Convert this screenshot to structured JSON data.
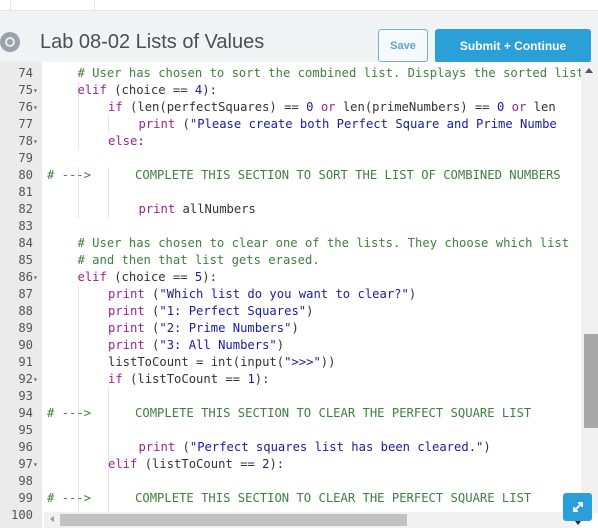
{
  "header": {
    "icon": "gear-icon",
    "title": "Lab 08-02 Lists of Values",
    "save_label": "Save",
    "submit_label": "Submit + Continue"
  },
  "colors": {
    "accent": "#2ba0d8",
    "comment": "#3f7f3f",
    "keyword": "#9b2393",
    "string": "#1a1aa6"
  },
  "editor": {
    "lines": [
      {
        "n": "74",
        "fold": false,
        "indent": 1,
        "tokens": [
          {
            "t": "cm",
            "v": "# User has chosen to sort the combined list. Displays the sorted list"
          }
        ]
      },
      {
        "n": "75",
        "fold": true,
        "indent": 1,
        "tokens": [
          {
            "t": "kw",
            "v": "elif"
          },
          {
            "t": "plain",
            "v": " (choice == "
          },
          {
            "t": "num",
            "v": "4"
          },
          {
            "t": "plain",
            "v": "):"
          }
        ]
      },
      {
        "n": "76",
        "fold": true,
        "indent": 2,
        "tokens": [
          {
            "t": "kw",
            "v": "if"
          },
          {
            "t": "plain",
            "v": " (len(perfectSquares) == "
          },
          {
            "t": "num",
            "v": "0"
          },
          {
            "t": "plain",
            "v": " "
          },
          {
            "t": "kw",
            "v": "or"
          },
          {
            "t": "plain",
            "v": " len(primeNumbers) == "
          },
          {
            "t": "num",
            "v": "0"
          },
          {
            "t": "plain",
            "v": " "
          },
          {
            "t": "kw",
            "v": "or"
          },
          {
            "t": "plain",
            "v": " len"
          }
        ]
      },
      {
        "n": "77",
        "fold": false,
        "indent": 3,
        "tokens": [
          {
            "t": "kw",
            "v": "print"
          },
          {
            "t": "plain",
            "v": " ("
          },
          {
            "t": "str",
            "v": "\"Please create both Perfect Square and Prime Numbe"
          }
        ]
      },
      {
        "n": "78",
        "fold": true,
        "indent": 2,
        "tokens": [
          {
            "t": "kw",
            "v": "else"
          },
          {
            "t": "plain",
            "v": ":"
          }
        ]
      },
      {
        "n": "79",
        "fold": false,
        "indent": 0,
        "tokens": []
      },
      {
        "n": "80",
        "fold": false,
        "indent": 0,
        "tokens": [
          {
            "t": "cm",
            "v": "# --->      COMPLETE THIS SECTION TO SORT THE LIST OF COMBINED NUMBERS"
          }
        ]
      },
      {
        "n": "81",
        "fold": false,
        "indent": 0,
        "tokens": []
      },
      {
        "n": "82",
        "fold": false,
        "indent": 3,
        "tokens": [
          {
            "t": "kw",
            "v": "print"
          },
          {
            "t": "plain",
            "v": " allNumbers"
          }
        ]
      },
      {
        "n": "83",
        "fold": false,
        "indent": 0,
        "tokens": []
      },
      {
        "n": "84",
        "fold": false,
        "indent": 1,
        "tokens": [
          {
            "t": "cm",
            "v": "# User has chosen to clear one of the lists. They choose which list"
          }
        ]
      },
      {
        "n": "85",
        "fold": false,
        "indent": 1,
        "tokens": [
          {
            "t": "cm",
            "v": "# and then that list gets erased."
          }
        ]
      },
      {
        "n": "86",
        "fold": true,
        "indent": 1,
        "tokens": [
          {
            "t": "kw",
            "v": "elif"
          },
          {
            "t": "plain",
            "v": " (choice == "
          },
          {
            "t": "num",
            "v": "5"
          },
          {
            "t": "plain",
            "v": "):"
          }
        ]
      },
      {
        "n": "87",
        "fold": false,
        "indent": 2,
        "tokens": [
          {
            "t": "kw",
            "v": "print"
          },
          {
            "t": "plain",
            "v": " ("
          },
          {
            "t": "str",
            "v": "\"Which list do you want to clear?\""
          },
          {
            "t": "plain",
            "v": ")"
          }
        ]
      },
      {
        "n": "88",
        "fold": false,
        "indent": 2,
        "tokens": [
          {
            "t": "kw",
            "v": "print"
          },
          {
            "t": "plain",
            "v": " ("
          },
          {
            "t": "str",
            "v": "\"1: Perfect Squares\""
          },
          {
            "t": "plain",
            "v": ")"
          }
        ]
      },
      {
        "n": "89",
        "fold": false,
        "indent": 2,
        "tokens": [
          {
            "t": "kw",
            "v": "print"
          },
          {
            "t": "plain",
            "v": " ("
          },
          {
            "t": "str",
            "v": "\"2: Prime Numbers\""
          },
          {
            "t": "plain",
            "v": ")"
          }
        ]
      },
      {
        "n": "90",
        "fold": false,
        "indent": 2,
        "tokens": [
          {
            "t": "kw",
            "v": "print"
          },
          {
            "t": "plain",
            "v": " ("
          },
          {
            "t": "str",
            "v": "\"3: All Numbers\""
          },
          {
            "t": "plain",
            "v": ")"
          }
        ]
      },
      {
        "n": "91",
        "fold": false,
        "indent": 2,
        "tokens": [
          {
            "t": "plain",
            "v": "listToCount = int(input("
          },
          {
            "t": "str",
            "v": "\">>>\""
          },
          {
            "t": "plain",
            "v": "))"
          }
        ]
      },
      {
        "n": "92",
        "fold": true,
        "indent": 2,
        "tokens": [
          {
            "t": "kw",
            "v": "if"
          },
          {
            "t": "plain",
            "v": " (listToCount == "
          },
          {
            "t": "num",
            "v": "1"
          },
          {
            "t": "plain",
            "v": "):"
          }
        ]
      },
      {
        "n": "93",
        "fold": false,
        "indent": 0,
        "tokens": []
      },
      {
        "n": "94",
        "fold": false,
        "indent": 0,
        "tokens": [
          {
            "t": "cm",
            "v": "# --->      COMPLETE THIS SECTION TO CLEAR THE PERFECT SQUARE LIST"
          }
        ]
      },
      {
        "n": "95",
        "fold": false,
        "indent": 0,
        "tokens": []
      },
      {
        "n": "96",
        "fold": false,
        "indent": 3,
        "tokens": [
          {
            "t": "kw",
            "v": "print"
          },
          {
            "t": "plain",
            "v": " ("
          },
          {
            "t": "str",
            "v": "\"Perfect squares list has been cleared.\""
          },
          {
            "t": "plain",
            "v": ")"
          }
        ]
      },
      {
        "n": "97",
        "fold": true,
        "indent": 2,
        "tokens": [
          {
            "t": "kw",
            "v": "elif"
          },
          {
            "t": "plain",
            "v": " (listToCount == "
          },
          {
            "t": "num",
            "v": "2"
          },
          {
            "t": "plain",
            "v": "):"
          }
        ]
      },
      {
        "n": "98",
        "fold": false,
        "indent": 0,
        "tokens": []
      },
      {
        "n": "99",
        "fold": false,
        "indent": 0,
        "tokens": [
          {
            "t": "cm",
            "v": "# --->      COMPLETE THIS SECTION TO CLEAR THE PERFECT SQUARE LIST"
          }
        ]
      },
      {
        "n": "100",
        "fold": false,
        "indent": 0,
        "tokens": []
      }
    ],
    "expand_icon": "expand-arrows-icon"
  }
}
